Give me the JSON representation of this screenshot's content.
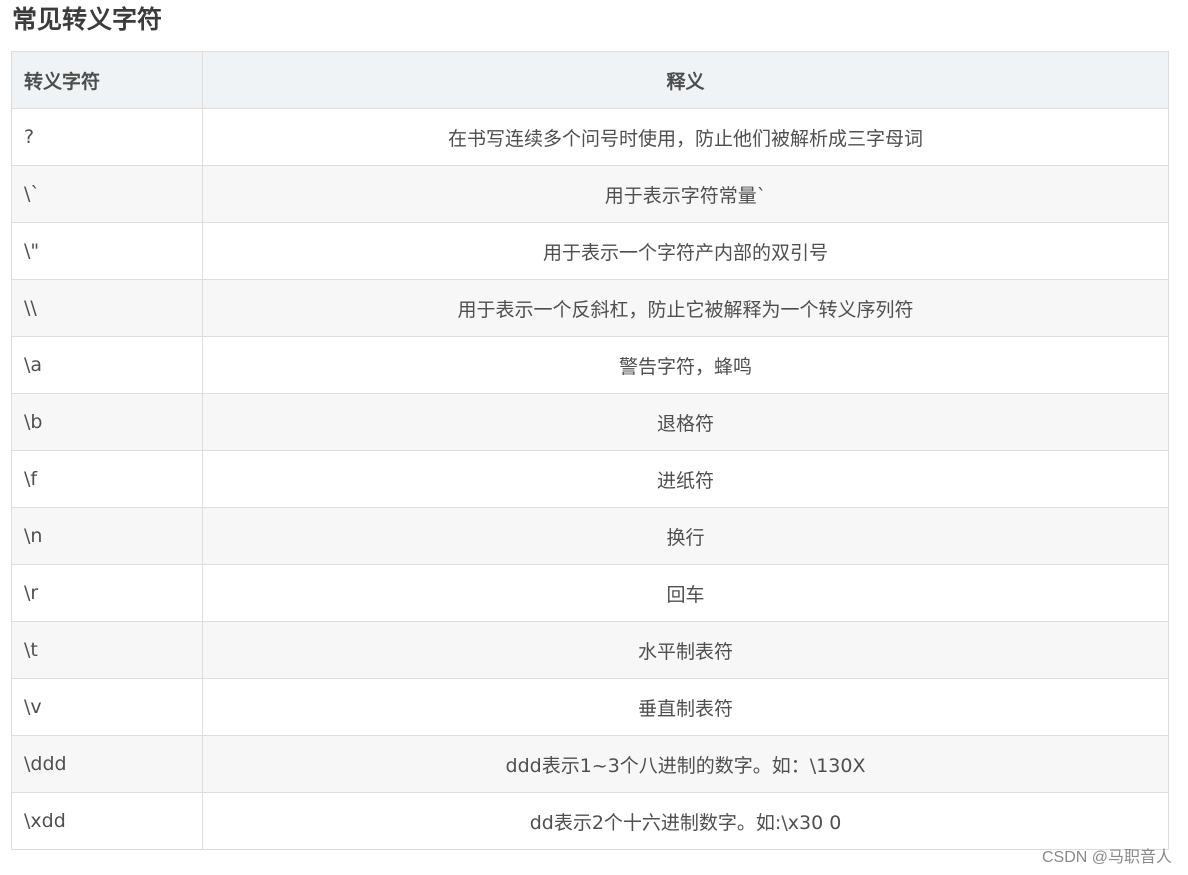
{
  "title": "常见转义字符",
  "table": {
    "headers": {
      "sequence": "转义字符",
      "meaning": "释义"
    },
    "rows": [
      {
        "sequence": "?",
        "meaning": "在书写连续多个问号时使用，防止他们被解析成三字母词"
      },
      {
        "sequence": "\\`",
        "meaning": "用于表示字符常量`"
      },
      {
        "sequence": "\\\"",
        "meaning": "用于表示一个字符产内部的双引号"
      },
      {
        "sequence": "\\\\",
        "meaning": "用于表示一个反斜杠，防止它被解释为一个转义序列符"
      },
      {
        "sequence": "\\a",
        "meaning": "警告字符，蜂鸣"
      },
      {
        "sequence": "\\b",
        "meaning": "退格符"
      },
      {
        "sequence": "\\f",
        "meaning": "进纸符"
      },
      {
        "sequence": "\\n",
        "meaning": "换行"
      },
      {
        "sequence": "\\r",
        "meaning": "回车"
      },
      {
        "sequence": "\\t",
        "meaning": "水平制表符"
      },
      {
        "sequence": "\\v",
        "meaning": "垂直制表符"
      },
      {
        "sequence": "\\ddd",
        "meaning": "ddd表示1~3个八进制的数字。如：\\130X"
      },
      {
        "sequence": "\\xdd",
        "meaning": "dd表示2个十六进制数字。如:\\x30 0"
      }
    ]
  },
  "watermark": "CSDN @马职音人"
}
